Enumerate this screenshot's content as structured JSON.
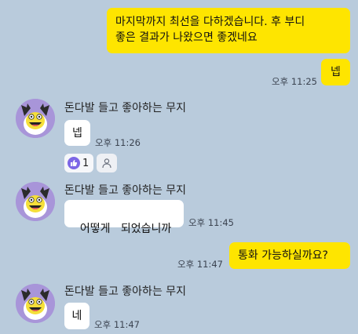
{
  "messages": {
    "m1": {
      "line1": "마지막까지 최선을 다하겠습니다. 후 부디",
      "line2": "좋은 결과가 나왔으면 좋겠네요"
    },
    "m2": {
      "text": "넵",
      "time": "오후 11:25"
    },
    "m3": {
      "sender": "돈다발 들고 좋아하는 무지",
      "text": "넵",
      "time": "오후 11:26"
    },
    "m4": {
      "sender": "돈다발 들고 좋아하는 무지",
      "text": "어떻게   되었습니까",
      "time": "오후 11:45"
    },
    "m5": {
      "text": "통화 가능하실까요?",
      "time": "오후 11:47"
    },
    "m6": {
      "sender": "돈다발 들고 좋아하는 무지",
      "text": "네",
      "time": "오후 11:47"
    }
  },
  "reaction": {
    "count": "1",
    "icon": "thumbs-up-icon",
    "add_icon": "person-icon"
  },
  "colors": {
    "background": "#b9cbdc",
    "my_bubble": "#fee500",
    "other_bubble": "#ffffff",
    "reaction_accent": "#7d67e6",
    "avatar_bg": "#a895d9"
  }
}
